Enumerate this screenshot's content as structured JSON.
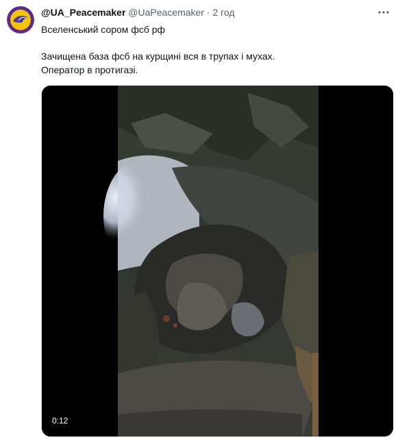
{
  "tweet": {
    "display_name": "@UA_Peacemaker",
    "handle": "@UaPeacemaker",
    "separator": "·",
    "time": "2 год",
    "line1": "Вселенський сором фсб рф",
    "line2": "Зачищена база фсб на курщині вся в трупах і мухах.",
    "line3": "Оператор в протигазі."
  },
  "video": {
    "duration": "0:12"
  },
  "icons": {
    "avatar": "peace-dove-icon",
    "more": "more-dots-icon"
  }
}
